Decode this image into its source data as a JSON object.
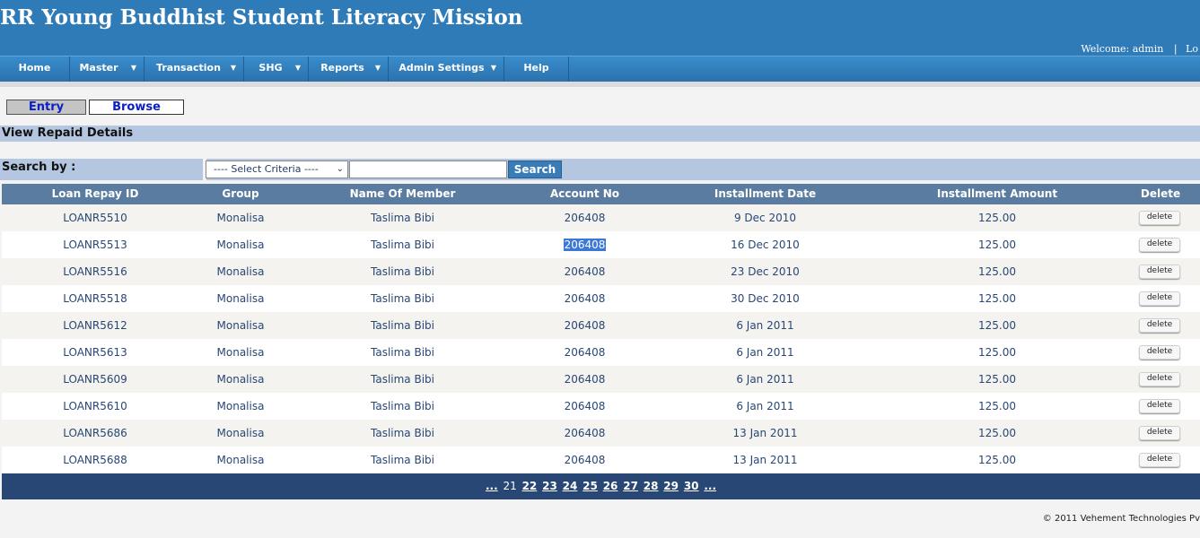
{
  "app": {
    "title": "RR Young Buddhist Student Literacy Mission",
    "welcome": "Welcome: admin",
    "separator": "|",
    "logout_partial": "Lo"
  },
  "nav": [
    {
      "label": "Home",
      "has_menu": false
    },
    {
      "label": "Master",
      "has_menu": true
    },
    {
      "label": "Transaction",
      "has_menu": true
    },
    {
      "label": "SHG",
      "has_menu": true
    },
    {
      "label": "Reports",
      "has_menu": true
    },
    {
      "label": "Admin Settings",
      "has_menu": true
    },
    {
      "label": "Help",
      "has_menu": false
    }
  ],
  "tabs": {
    "entry": "Entry",
    "browse": "Browse"
  },
  "section_title": "View Repaid Details",
  "search": {
    "label": "Search by :",
    "criteria_selected": "---- Select Criteria ----",
    "input_value": "",
    "button": "Search"
  },
  "table": {
    "headers": [
      "Loan Repay ID",
      "Group",
      "Name Of Member",
      "Account No",
      "Installment Date",
      "Installment Amount",
      "Delete"
    ],
    "delete_label": "delete",
    "rows": [
      [
        "LOANR5510",
        "Monalisa",
        "Taslima Bibi",
        "206408",
        "9 Dec 2010",
        "125.00"
      ],
      [
        "LOANR5513",
        "Monalisa",
        "Taslima Bibi",
        "206408",
        "16 Dec 2010",
        "125.00"
      ],
      [
        "LOANR5516",
        "Monalisa",
        "Taslima Bibi",
        "206408",
        "23 Dec 2010",
        "125.00"
      ],
      [
        "LOANR5518",
        "Monalisa",
        "Taslima Bibi",
        "206408",
        "30 Dec 2010",
        "125.00"
      ],
      [
        "LOANR5612",
        "Monalisa",
        "Taslima Bibi",
        "206408",
        "6 Jan 2011",
        "125.00"
      ],
      [
        "LOANR5613",
        "Monalisa",
        "Taslima Bibi",
        "206408",
        "6 Jan 2011",
        "125.00"
      ],
      [
        "LOANR5609",
        "Monalisa",
        "Taslima Bibi",
        "206408",
        "6 Jan 2011",
        "125.00"
      ],
      [
        "LOANR5610",
        "Monalisa",
        "Taslima Bibi",
        "206408",
        "6 Jan 2011",
        "125.00"
      ],
      [
        "LOANR5686",
        "Monalisa",
        "Taslima Bibi",
        "206408",
        "13 Jan 2011",
        "125.00"
      ],
      [
        "LOANR5688",
        "Monalisa",
        "Taslima Bibi",
        "206408",
        "13 Jan 2011",
        "125.00"
      ]
    ]
  },
  "pager": {
    "prev": "...",
    "current": "21",
    "pages": [
      "22",
      "23",
      "24",
      "25",
      "26",
      "27",
      "28",
      "29",
      "30"
    ],
    "next": "..."
  },
  "footer": "© 2011 Vehement Technologies Pv"
}
